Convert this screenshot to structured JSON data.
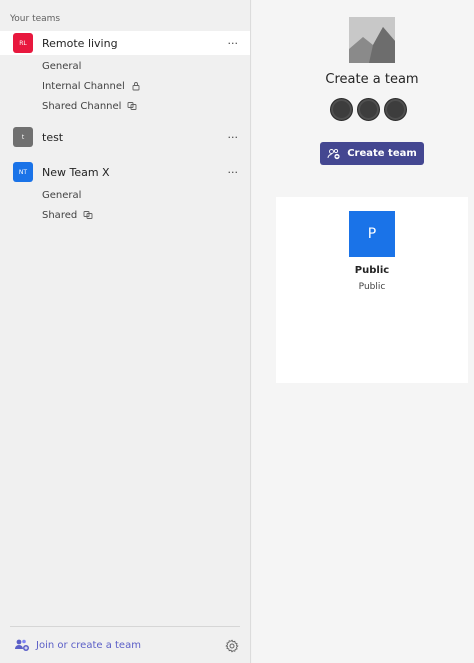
{
  "sidebar": {
    "section_label": "Your teams",
    "teams": [
      {
        "initials": "RL",
        "name": "Remote living",
        "color": "#e8183e",
        "more": "···",
        "channels": [
          {
            "label": "General"
          },
          {
            "label": "Internal Channel",
            "icon": "lock-icon"
          },
          {
            "label": "Shared Channel",
            "icon": "shared-icon"
          }
        ]
      },
      {
        "initials": "t",
        "name": "test",
        "color": "#707070",
        "more": "···",
        "channels": []
      },
      {
        "initials": "NT",
        "name": "New Team X",
        "color": "#1a73e8",
        "more": "···",
        "channels": [
          {
            "label": "General"
          },
          {
            "label": "Shared",
            "icon": "shared-icon"
          }
        ]
      }
    ],
    "footer": {
      "join_label": "Join or create a team",
      "accent": "#5b5fc7"
    }
  },
  "main": {
    "create_title": "Create a team",
    "create_button": "Create team",
    "button_color": "#444791",
    "public_card": {
      "tile_letter": "P",
      "title": "Public",
      "subtitle": "Public",
      "tile_color": "#1a73e8"
    }
  }
}
